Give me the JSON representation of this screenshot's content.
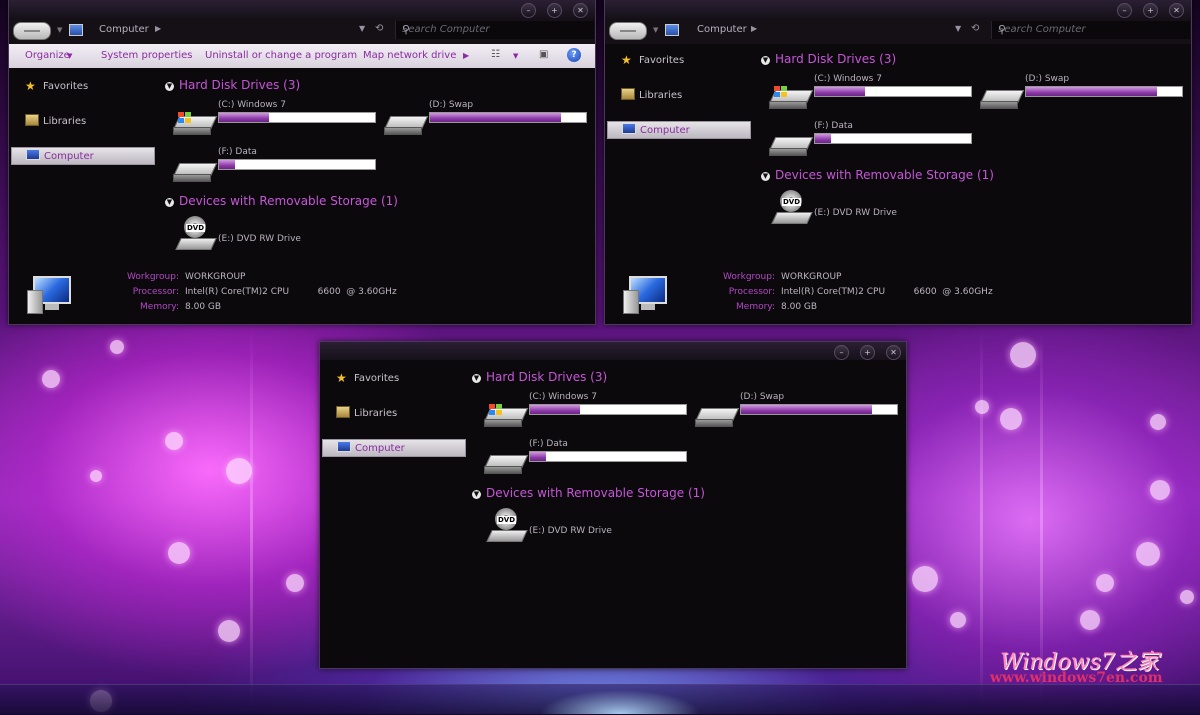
{
  "nav_items": [
    {
      "label": "Favorites",
      "icon": "star-icon"
    },
    {
      "label": "Libraries",
      "icon": "libraries-icon"
    },
    {
      "label": "Computer",
      "icon": "computer-icon",
      "selected": true
    }
  ],
  "breadcrumb": "Computer",
  "search_placeholder": "Search Computer",
  "toolbar": {
    "organize": "Organize",
    "system_properties": "System properties",
    "uninstall": "Uninstall or change a program",
    "map_drive": "Map network drive"
  },
  "groups": {
    "hard_disk": "Hard Disk Drives (3)",
    "removable": "Devices with Removable Storage (1)"
  },
  "drives": [
    {
      "label": "(C:) Windows 7",
      "used_fraction": 0.32,
      "icon": "windows-drive-icon"
    },
    {
      "label": "(D:) Swap",
      "used_fraction": 0.84,
      "icon": "hard-drive-icon"
    },
    {
      "label": "(F:) Data",
      "used_fraction": 0.1,
      "icon": "hard-drive-icon"
    }
  ],
  "dvd": {
    "label": "(E:) DVD RW Drive",
    "icon_text": "DVD"
  },
  "details": {
    "workgroup_label": "Workgroup:",
    "workgroup": "WORKGROUP",
    "processor_label": "Processor:",
    "processor": "Intel(R) Core(TM)2 CPU          6600  @ 3.60GHz",
    "memory_label": "Memory:",
    "memory": "8.00 GB"
  },
  "window_controls": {
    "minimize": "–",
    "maximize": "+",
    "close": "✕"
  },
  "watermark": {
    "line1": "Windows7之家",
    "line2": "www.windows7en.com"
  },
  "colors": {
    "accent": "#c656d8",
    "bar_fill": "#8e3ca8"
  }
}
